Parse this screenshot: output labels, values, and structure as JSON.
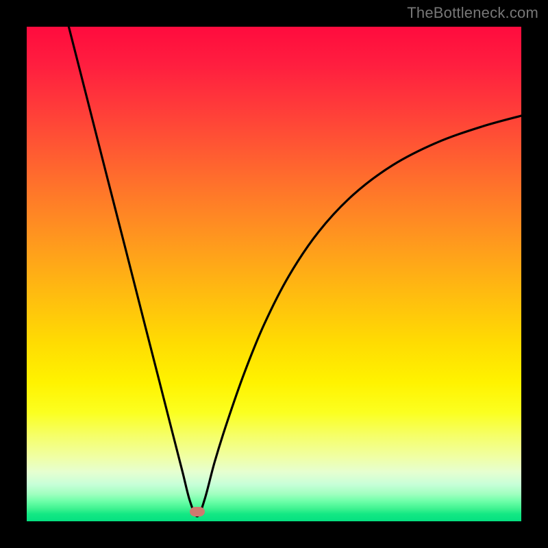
{
  "watermark": "TheBottleneck.com",
  "layout": {
    "image_size": 800,
    "plot_inset": 39,
    "plot_size": 722
  },
  "chart_data": {
    "type": "line",
    "title": "",
    "xlabel": "",
    "ylabel": "",
    "xlim": [
      0,
      100
    ],
    "ylim": [
      0,
      100
    ],
    "grid": false,
    "legend": false,
    "marker": {
      "x": 34.5,
      "y": 2.0,
      "color": "#cf796f"
    },
    "series": [
      {
        "name": "curve",
        "stroke": "#000000",
        "stroke_width": 3.2,
        "x": [
          8.5,
          12,
          16,
          20,
          24,
          27,
          29.5,
          31.5,
          33,
          34.5,
          36,
          38,
          40.5,
          44,
          48,
          53,
          59,
          66,
          74,
          83,
          92,
          100
        ],
        "y": [
          100,
          86.3,
          70.6,
          55.0,
          39.3,
          27.6,
          17.8,
          10.0,
          4.1,
          1.0,
          4.5,
          12.0,
          20.0,
          30.0,
          39.8,
          49.6,
          58.5,
          66.0,
          72.0,
          76.6,
          79.8,
          82.0
        ]
      }
    ],
    "gradient_stops": [
      {
        "pos": 0,
        "color": "#ff0b3e"
      },
      {
        "pos": 50,
        "color": "#ffbd10"
      },
      {
        "pos": 75,
        "color": "#fdff30"
      },
      {
        "pos": 90,
        "color": "#e6ffd0"
      },
      {
        "pos": 100,
        "color": "#05e080"
      }
    ]
  }
}
